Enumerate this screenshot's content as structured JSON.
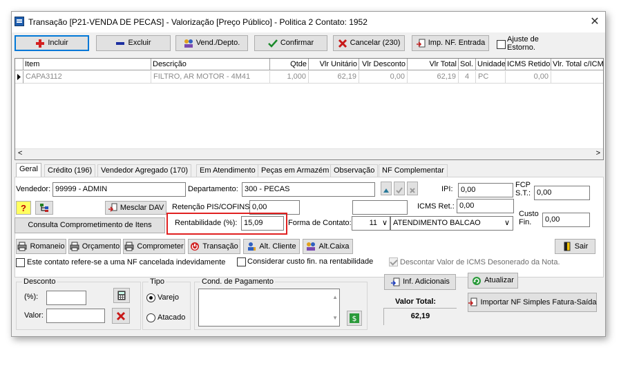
{
  "window": {
    "title": "Transação [P21-VENDA DE PECAS] - Valorização [Preço Público] - Politica 2  Contato: 1952",
    "close_glyph": "✕"
  },
  "toolbar": {
    "incluir": "Incluir",
    "excluir": "Excluir",
    "vend_depto": "Vend./Depto.",
    "confirmar": "Confirmar",
    "cancelar": "Cancelar (230)",
    "imp_nf_entrada": "Imp. NF. Entrada",
    "ajuste_estorno": "Ajuste de Estorno."
  },
  "grid": {
    "columns": [
      "Item",
      "Descrição",
      "Qtde",
      "Vlr Unitário",
      "Vlr Desconto",
      "Vlr Total",
      "Sol.",
      "Unidade",
      "ICMS Retido",
      "Vlr. Total c/ICMS"
    ],
    "rows": [
      [
        "CAPA3112",
        "FILTRO, AR MOTOR - 4M41",
        "1,000",
        "62,19",
        "0,00",
        "62,19",
        "4",
        "PC",
        "0,00",
        ""
      ]
    ],
    "scroll_left": "<",
    "scroll_right": ">"
  },
  "tabs": [
    "Geral",
    "Crédito (196)",
    "Vendedor Agregado (170)",
    "Em Atendimento",
    "Peças em Armazém",
    "Observação",
    "NF Complementar"
  ],
  "geral": {
    "vendedor_label": "Vendedor:",
    "vendedor_value": "99999 - ADMIN",
    "departamento_label": "Departamento:",
    "departamento_value": "300 - PECAS",
    "ipi_label": "IPI:",
    "ipi_value": "0,00",
    "fcp_label": "FCP\nS.T.:",
    "fcp_value": "0,00",
    "help_glyph": "?",
    "mesclar_dav": "Mesclar DAV",
    "retencao_label": "Retenção PIS/COFINS:",
    "retencao_value": "0,00",
    "icms_ret_label": "ICMS Ret.:",
    "icms_ret_value": "0,00",
    "custo_fin_label": "Custo\nFin.",
    "custo_fin_value": "0,00",
    "consulta_comprometimento": "Consulta Comprometimento de Itens",
    "rentabilidade_label": "Rentabilidade (%):",
    "rentabilidade_value": "15,09",
    "forma_contato_label": "Forma de Contato:",
    "forma_contato_code": "11",
    "forma_contato_value": "ATENDIMENTO BALCAO",
    "chevron": "∨"
  },
  "actions": {
    "romaneio": "Romaneio",
    "orcamento": "Orçamento",
    "comprometer": "Comprometer",
    "transacao": "Transação",
    "alt_cliente": "Alt. Cliente",
    "alt_caixa": "Alt.Caixa",
    "sair": "Sair"
  },
  "checks": {
    "nf_cancelada": "Este contato refere-se a uma NF cancelada indevidamente",
    "custo_fin": "Considerar custo fin. na rentabilidade",
    "descontar_icms": "Descontar Valor de ICMS Desonerado da Nota."
  },
  "desconto": {
    "title": "Desconto",
    "pct_label": "(%):",
    "valor_label": "Valor:"
  },
  "tipo": {
    "title": "Tipo",
    "varejo": "Varejo",
    "atacado": "Atacado"
  },
  "pagamento": {
    "title": "Cond. de Pagamento"
  },
  "bottom": {
    "inf_adicionais": "Inf. Adicionais",
    "atualizar": "Atualizar",
    "importar_nf": "Importar NF Simples Fatura-Saída",
    "valor_total_label": "Valor Total:",
    "valor_total_value": "62,19"
  },
  "colors": {
    "highlight_border": "#e02020",
    "accent": "#0078d7"
  }
}
